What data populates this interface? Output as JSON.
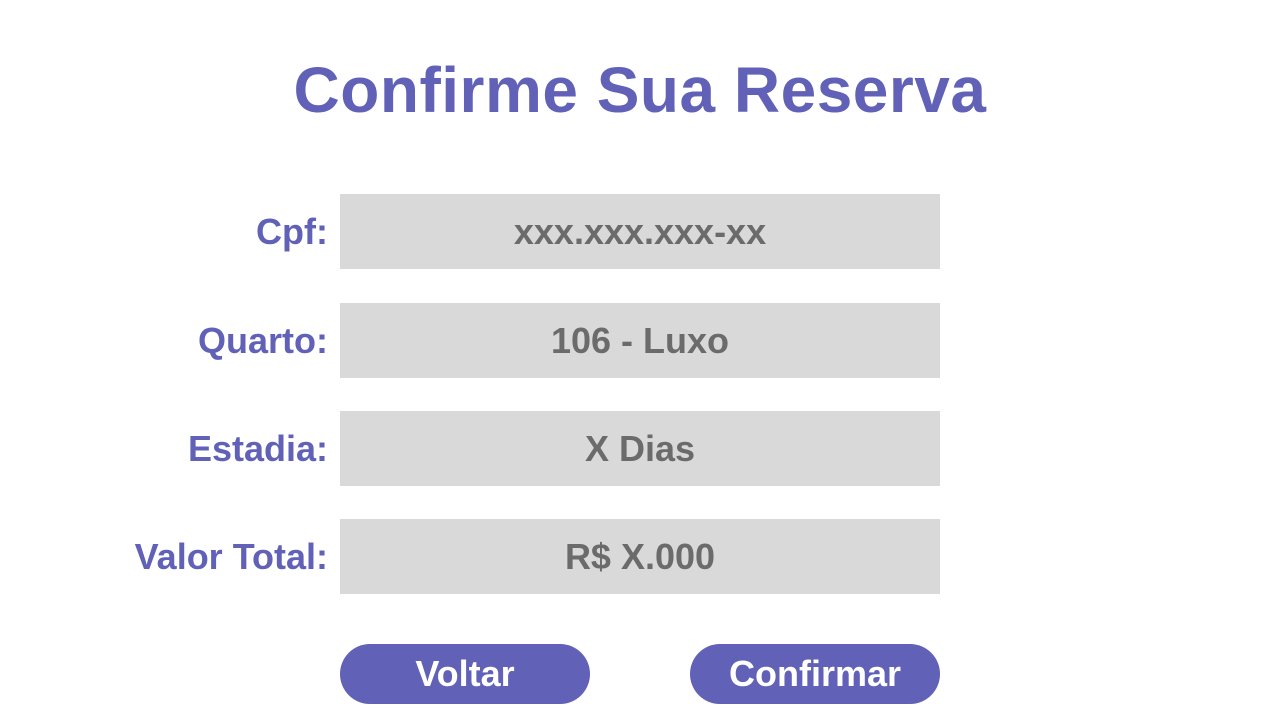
{
  "page": {
    "title": "Confirme Sua Reserva"
  },
  "form": {
    "cpf": {
      "label": "Cpf:",
      "value": "xxx.xxx.xxx-xx"
    },
    "quarto": {
      "label": "Quarto:",
      "value": "106 - Luxo"
    },
    "estadia": {
      "label": "Estadia:",
      "value": "X Dias"
    },
    "valor_total": {
      "label": "Valor Total:",
      "value": "R$ X.000"
    }
  },
  "actions": {
    "back_label": "Voltar",
    "confirm_label": "Confirmar"
  },
  "colors": {
    "accent": "#6061b7",
    "field_background": "#d9d9d9",
    "field_text": "#6b6b6b",
    "background": "#ffffff"
  }
}
